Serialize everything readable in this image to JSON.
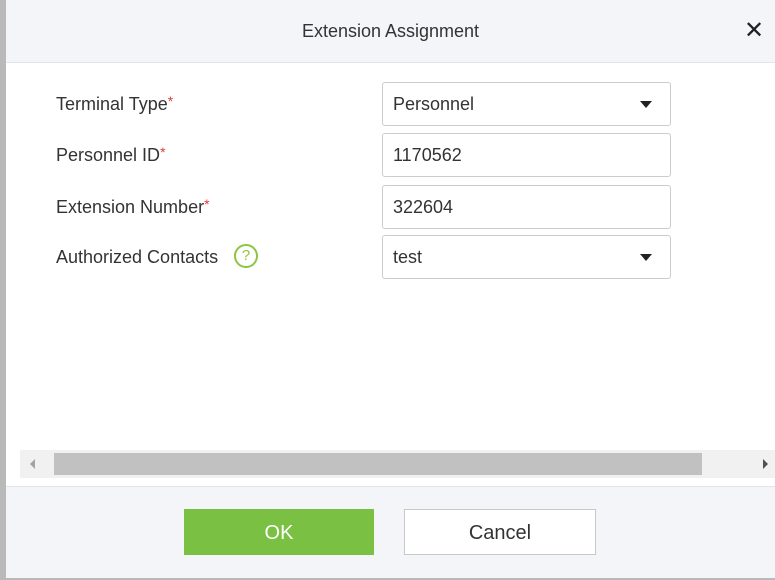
{
  "dialog": {
    "title": "Extension Assignment",
    "close_glyph": "✕"
  },
  "form": {
    "required_marker": "*",
    "terminal_type": {
      "label": "Terminal Type",
      "value": "Personnel"
    },
    "personnel_id": {
      "label": "Personnel ID",
      "value": "1170562"
    },
    "extension_number": {
      "label": "Extension Number",
      "value": "322604"
    },
    "authorized_contacts": {
      "label": "Authorized Contacts",
      "value": "test",
      "help_glyph": "?"
    }
  },
  "buttons": {
    "ok_label": "OK",
    "cancel_label": "Cancel"
  },
  "colors": {
    "ok_button": "#7ac143",
    "required_marker": "#e5393b",
    "help_icon": "#8cc63f"
  },
  "icons": {
    "close": "close-icon",
    "dropdown": "chevron-down-icon",
    "help": "help-icon"
  }
}
